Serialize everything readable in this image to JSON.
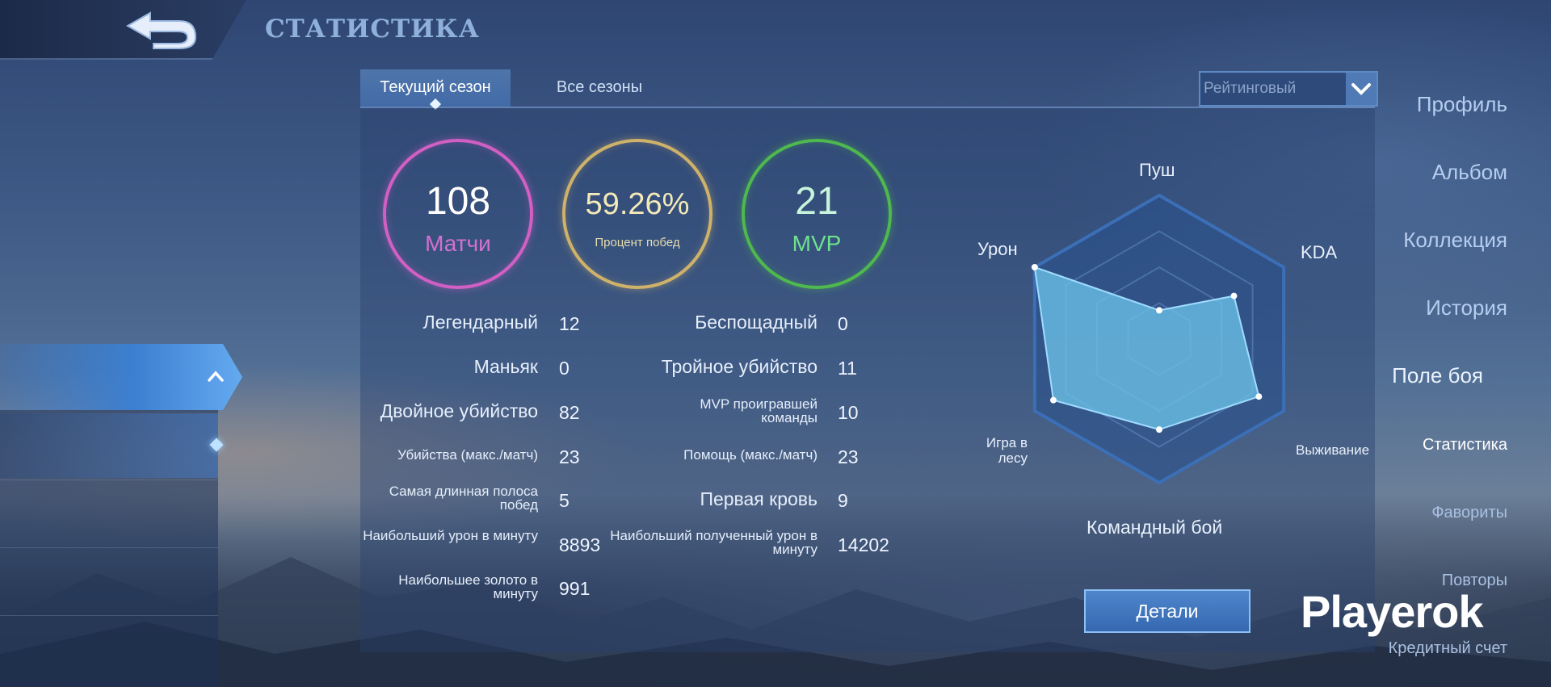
{
  "header": {
    "title": "СТАТИСТИКА"
  },
  "sidebar": {
    "items": [
      {
        "label": "Профиль"
      },
      {
        "label": "Альбом"
      },
      {
        "label": "Коллекция"
      },
      {
        "label": "История"
      },
      {
        "label": "Поле боя"
      }
    ],
    "subitems": [
      {
        "label": "Статистика"
      },
      {
        "label": "Фавориты"
      },
      {
        "label": "Повторы"
      },
      {
        "label": "Кредитный счет"
      }
    ]
  },
  "tabs": [
    {
      "label": "Текущий сезон"
    },
    {
      "label": "Все сезоны"
    }
  ],
  "mode_select": {
    "value": "Рейтинговый"
  },
  "summary": {
    "matches": {
      "value": "108",
      "label": "Матчи"
    },
    "winrate": {
      "value": "59.26%",
      "label": "Процент побед"
    },
    "mvp": {
      "value": "21",
      "label": "MVP"
    }
  },
  "stats_left": [
    {
      "label": "Легендарный",
      "value": "12"
    },
    {
      "label": "Маньяк",
      "value": "0"
    },
    {
      "label": "Двойное убийство",
      "value": "82"
    },
    {
      "label": "Убийства (макс./матч)",
      "value": "23"
    },
    {
      "label": "Самая длинная полоса побед",
      "value": "5"
    },
    {
      "label": "Наибольший урон в минуту",
      "value": "8893"
    },
    {
      "label": "Наибольшее золото в минуту",
      "value": "991"
    }
  ],
  "stats_right": [
    {
      "label": "Беспощадный",
      "value": "0"
    },
    {
      "label": "Тройное убийство",
      "value": "11"
    },
    {
      "label": "MVP проигравшей команды",
      "value": "10"
    },
    {
      "label": "Помощь (макс./матч)",
      "value": "23"
    },
    {
      "label": "Первая кровь",
      "value": "9"
    },
    {
      "label": "Наибольший полученный урон в минуту",
      "value": "14202"
    }
  ],
  "radar": {
    "axes": [
      {
        "label": "Пуш",
        "level": 0.2
      },
      {
        "label": "KDA",
        "level": 0.6
      },
      {
        "label": "Выживание",
        "level": 0.8
      },
      {
        "label": "Командный бой",
        "level": 0.63
      },
      {
        "label": "Игра в лесу",
        "level": 0.85
      },
      {
        "label": "Урон",
        "level": 1.0
      }
    ]
  },
  "details_button": {
    "label": "Детали"
  },
  "watermark": {
    "text": "Playerok"
  },
  "colors": {
    "matches_ring": "#d25fc4",
    "winrate_ring": "#cfb26a",
    "mvp_ring": "#4fb84e",
    "radar_fill": "#6cc2e8",
    "accent": "#4f86cc"
  }
}
